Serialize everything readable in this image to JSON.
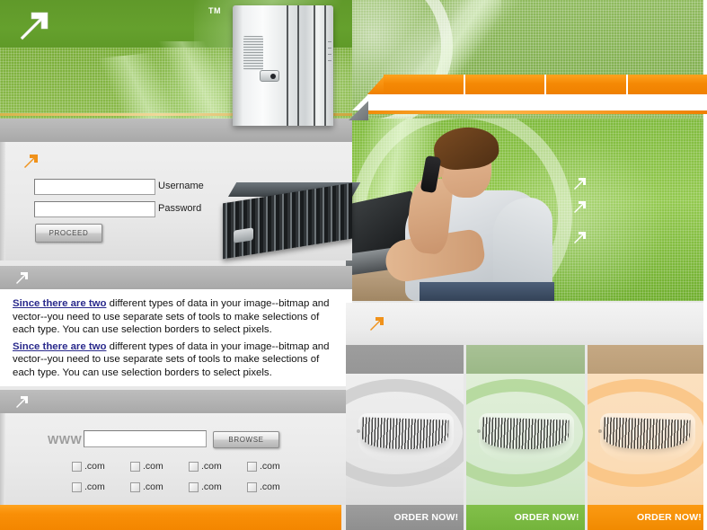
{
  "header": {
    "logo_icon": "arrow-up-right-icon",
    "trademark": "TM",
    "tower_image_alt": "server-tower"
  },
  "topnav": {
    "items": [
      {
        "label": ""
      },
      {
        "label": ""
      },
      {
        "label": ""
      },
      {
        "label": ""
      }
    ]
  },
  "hero": {
    "image_alt": "man-on-phone-with-laptop",
    "bullet_icons": [
      "arrow-up-right-icon",
      "arrow-up-right-icon",
      "arrow-up-right-icon"
    ]
  },
  "login": {
    "section_icon": "arrow-up-right-icon",
    "username": {
      "label": "Username",
      "value": "",
      "placeholder": ""
    },
    "password": {
      "label": "Password",
      "value": "",
      "placeholder": ""
    },
    "submit_label": "PROCEED",
    "rack_image_alt": "rack-server"
  },
  "content": {
    "section_icon": "arrow-up-right-icon",
    "paragraphs": [
      {
        "link_text": "Since there are two",
        "body": " different types of data in your image--bitmap and vector--you need to use separate sets of tools to make selections of each type. You can use selection borders to select pixels."
      },
      {
        "link_text": "Since there are two",
        "body": " different types of data in your image--bitmap and vector--you need to use separate sets of tools to make selections of each type. You can use selection borders to select pixels."
      }
    ]
  },
  "domain": {
    "section_icon": "arrow-up-right-icon",
    "prefix_label": "WWW",
    "input": {
      "value": "",
      "placeholder": ""
    },
    "browse_label": "BROWSE",
    "tlds": [
      {
        "label": ".com",
        "checked": false
      },
      {
        "label": ".com",
        "checked": false
      },
      {
        "label": ".com",
        "checked": false
      },
      {
        "label": ".com",
        "checked": false
      },
      {
        "label": ".com",
        "checked": false
      },
      {
        "label": ".com",
        "checked": false
      },
      {
        "label": ".com",
        "checked": false
      },
      {
        "label": ".com",
        "checked": false
      }
    ]
  },
  "products": {
    "section_icon": "arrow-up-right-icon",
    "cards": [
      {
        "theme": "gray",
        "order_label": "ORDER NOW!",
        "image_alt": "product-device-gray"
      },
      {
        "theme": "green",
        "order_label": "ORDER NOW!",
        "image_alt": "product-device-green"
      },
      {
        "theme": "orange",
        "order_label": "ORDER NOW!",
        "image_alt": "product-device-orange"
      }
    ]
  },
  "colors": {
    "green_primary": "#6ba22e",
    "green_light": "#8fba5e",
    "orange_accent": "#f58905",
    "gray_bar": "#b2b2b2",
    "panel_light": "#efefef",
    "link_blue": "#2a2a8c",
    "card_gray": "#9d9d9d",
    "card_green": "#82c04a",
    "card_orange": "#fb9a13"
  }
}
